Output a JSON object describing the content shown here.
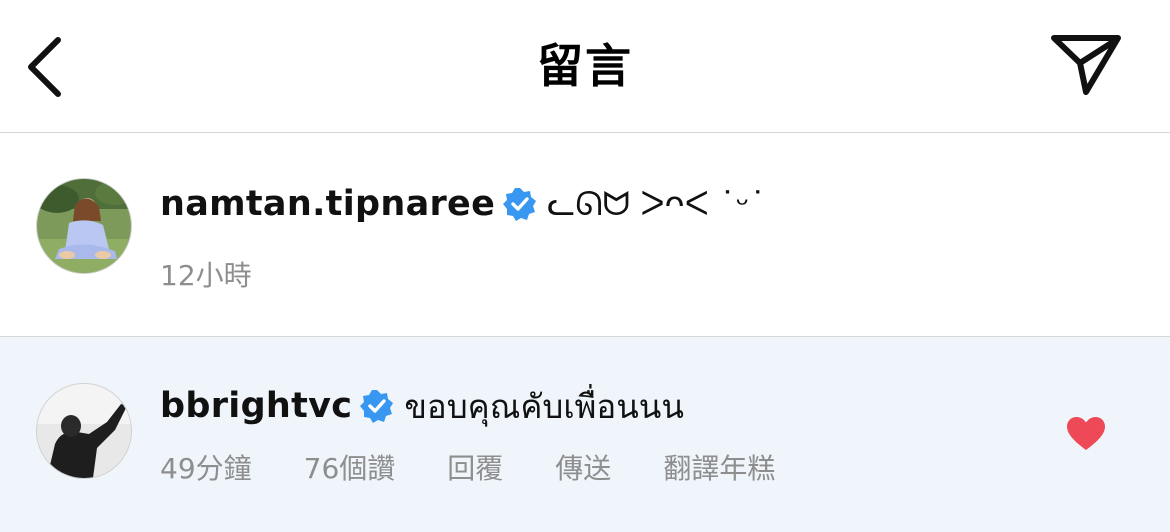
{
  "header": {
    "title": "留言",
    "back_icon": "chevron-left-icon",
    "share_icon": "paper-plane-icon"
  },
  "comments": [
    {
      "username": "namtan.tipnaree",
      "verified": true,
      "text": "ᓚᘏᗢ ᐳᴖᐸ ˙ᵕ˙",
      "time": "12小時"
    },
    {
      "username": "bbrightvc",
      "verified": true,
      "text": "ขอบคุณคับเพื่อนนน",
      "time": "49分鐘",
      "likes": "76個讚",
      "reply_label": "回覆",
      "send_label": "傳送",
      "translate_label": "翻譯年糕",
      "liked": true
    }
  ],
  "colors": {
    "verified_blue": "#3897f0",
    "heart_red": "#ed4956",
    "meta_gray": "#8e8e8e",
    "highlight_bg": "#eff5fb",
    "divider": "#d6d6d6"
  }
}
